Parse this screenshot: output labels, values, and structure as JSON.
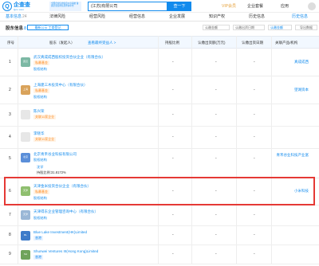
{
  "header": {
    "logo_cn": "企查查",
    "logo_en": "Qcc.com",
    "promo": "全国企业信用信息公示系统 备案企业信用信息查询平台",
    "search_value": "(江苏)有限公司",
    "search_button": "查一下",
    "vip": "VIP会员",
    "enterprise": "企业套餐",
    "app": "应用"
  },
  "tabs": [
    {
      "label": "基本信息",
      "badge": "24"
    },
    {
      "label": "法律风险",
      "badge": ""
    },
    {
      "label": "经营风险",
      "badge": ""
    },
    {
      "label": "经营信息",
      "badge": ""
    },
    {
      "label": "企业发展",
      "badge": ""
    },
    {
      "label": "知识产权",
      "badge": ""
    },
    {
      "label": "历史信息",
      "badge": ""
    },
    {
      "label": "历史信息",
      "badge": ""
    }
  ],
  "section": {
    "title": "股东信息",
    "count": "8",
    "tag": "最新公示 工商登记",
    "filter1": "认缴金额",
    "filter2": "认缴出资日期",
    "export": "导出数据"
  },
  "table": {
    "headers": {
      "idx": "序号",
      "holder": "股东（发起人）",
      "holder_link": "查看最终受益人 >",
      "ratio": "持股比例",
      "amount": "认缴出资额(万元)",
      "date": "认缴出资日期",
      "product": "关联产品/机构"
    },
    "rows": [
      {
        "idx": "1",
        "avatar": "武汉",
        "name": "武汉真成成西股权投资合伙企业（有限合伙）",
        "tag": "私募基金",
        "link": "股权结构",
        "ratio": "-",
        "amount": "-",
        "date": "-",
        "product": "真成成西"
      },
      {
        "idx": "2",
        "avatar": "上海",
        "name": "上海建三木投资中心（有限合伙）",
        "tag": "私募基金",
        "link": "股权结构",
        "ratio": "-",
        "amount": "-",
        "date": "-",
        "product": "望湖资本"
      },
      {
        "idx": "3",
        "avatar": "",
        "name": "陈兴荣",
        "tag": "关联11家企业",
        "link": "",
        "ratio": "-",
        "amount": "-",
        "date": "-",
        "product": ""
      },
      {
        "idx": "4",
        "avatar": "",
        "name": "李晓华",
        "tag": "关联11家企业",
        "link": "",
        "ratio": "-",
        "amount": "-",
        "date": "-",
        "product": ""
      },
      {
        "idx": "5",
        "avatar": "北京",
        "name": "北京青禾谷业科技有限公司",
        "tag": "",
        "link": "股权结构",
        "ratio": "-",
        "amount": "-",
        "date": "-",
        "product": "青禾谷业科技产业富",
        "sub_name": "沈学",
        "sub_ratio": "持股比例:31.8172%"
      },
      {
        "idx": "6",
        "avatar": "天津",
        "name": "天津金米投资合伙企业（有限合伙）",
        "tag": "私募基金",
        "link": "股权结构",
        "ratio": "-",
        "amount": "-",
        "date": "-",
        "product": "小米科技"
      },
      {
        "idx": "7",
        "avatar": "天津",
        "name": "天津得东企业管理咨询中心（有限合伙）",
        "tag": "",
        "link": "股权结构",
        "ratio": "-",
        "amount": "-",
        "date": "-",
        "product": ""
      },
      {
        "idx": "8",
        "avatar": "BL",
        "name": "Blue Lake Investment(HK)Limited",
        "tag": "香港",
        "link": "",
        "ratio": "-",
        "amount": "-",
        "date": "-",
        "product": ""
      },
      {
        "idx": "9",
        "avatar": "SH",
        "name": "Shunwei Ventures III(Hong Kong)Limited",
        "tag": "香港",
        "link": "",
        "ratio": "-",
        "amount": "-",
        "date": "-",
        "product": ""
      }
    ]
  }
}
